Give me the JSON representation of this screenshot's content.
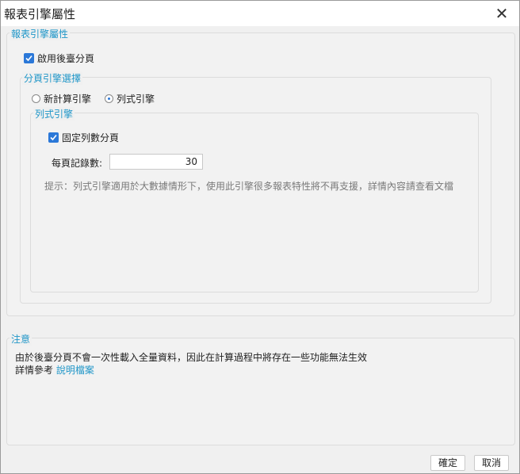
{
  "window": {
    "title": "報表引擎屬性",
    "close_label": "✕"
  },
  "engine_group": {
    "legend": "報表引擎屬性",
    "enable_paging": {
      "label": "啟用後臺分頁",
      "checked": true
    },
    "selection_group": {
      "legend": "分頁引擎選擇",
      "options": [
        {
          "label": "新計算引擎",
          "selected": false
        },
        {
          "label": "列式引擎",
          "selected": true
        }
      ]
    },
    "columnar_group": {
      "legend": "列式引擎",
      "fixed_rows": {
        "label": "固定列數分頁",
        "checked": true
      },
      "records_per_page": {
        "label": "每頁記錄數:",
        "value": "30"
      },
      "hint": "提示：列式引擎適用於大數據情形下，使用此引擎很多報表特性將不再支援，詳情內容請查看文檔"
    }
  },
  "note_group": {
    "legend": "注意",
    "line1": "由於後臺分頁不會一次性載入全量資料，因此在計算過程中將存在一些功能無法生效",
    "line2_prefix": "詳情參考 ",
    "line2_link": "說明檔案"
  },
  "buttons": {
    "ok": "確定",
    "cancel": "取消"
  },
  "colors": {
    "accent": "#1f96c8",
    "checkbox": "#2b78d8"
  }
}
